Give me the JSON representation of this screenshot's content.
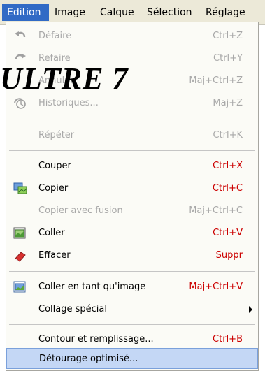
{
  "menubar": {
    "items": [
      "Edition",
      "Image",
      "Calque",
      "Sélection",
      "Réglage"
    ]
  },
  "overlay_title": "ULTRE 7",
  "menu": {
    "undo": {
      "label": "Défaire",
      "shortcut": "Ctrl+Z"
    },
    "redo": {
      "label": "Refaire",
      "shortcut": "Ctrl+Y"
    },
    "cancel": {
      "label": "Annuler",
      "shortcut": "Maj+Ctrl+Z"
    },
    "history": {
      "label": "Historiques...",
      "shortcut": "Maj+Z"
    },
    "repeat": {
      "label": "Répéter",
      "shortcut": "Ctrl+K"
    },
    "cut": {
      "label": "Couper",
      "shortcut": "Ctrl+X"
    },
    "copy": {
      "label": "Copier",
      "shortcut": "Ctrl+C"
    },
    "copy_merged": {
      "label": "Copier avec fusion",
      "shortcut": "Maj+Ctrl+C"
    },
    "paste": {
      "label": "Coller",
      "shortcut": "Ctrl+V"
    },
    "erase": {
      "label": "Effacer",
      "shortcut": "Suppr"
    },
    "paste_as_image": {
      "label": "Coller en tant qu'image",
      "shortcut": "Maj+Ctrl+V"
    },
    "paste_special": {
      "label": "Collage spécial"
    },
    "stroke_fill": {
      "label": "Contour et remplissage...",
      "shortcut": "Ctrl+B"
    },
    "smart_cutout": {
      "label": "Détourage optimisé..."
    }
  },
  "colors": {
    "menubar_bg": "#ece9d8",
    "active_menu": "#316ac5",
    "shortcut_red": "#cc0000",
    "disabled_gray": "#a8a8a8",
    "highlight_bg": "#c4d7f5"
  }
}
